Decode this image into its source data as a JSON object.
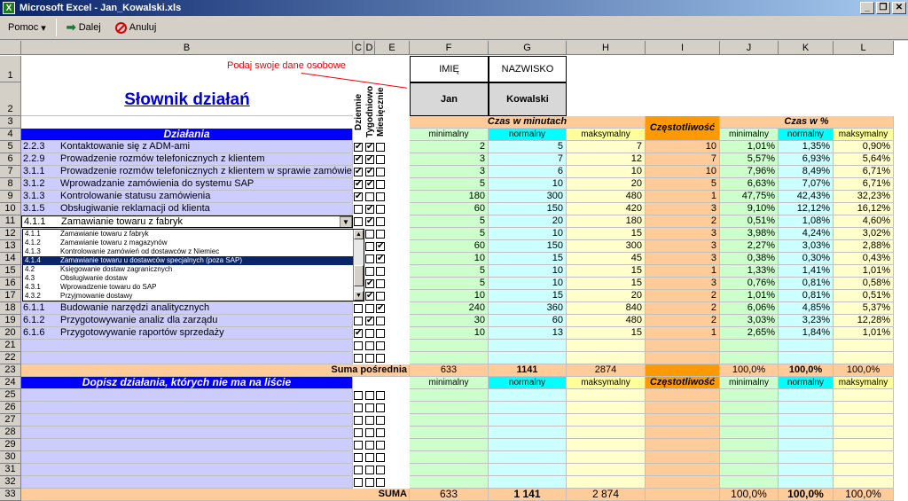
{
  "window": {
    "title": "Microsoft Excel - Jan_Kowalski.xls",
    "app_icon": "X"
  },
  "toolbar": {
    "help": "Pomoc",
    "next": "Dalej",
    "cancel": "Anuluj"
  },
  "columns": [
    "B",
    "C",
    "D",
    "E",
    "F",
    "G",
    "H",
    "I",
    "J",
    "K",
    "L"
  ],
  "rows": [
    "1",
    "2",
    "3",
    "4",
    "5",
    "6",
    "7",
    "8",
    "9",
    "10",
    "11",
    "12",
    "13",
    "14",
    "15",
    "16",
    "17",
    "18",
    "19",
    "20",
    "21",
    "22",
    "23",
    "24",
    "25",
    "26",
    "27",
    "28",
    "29",
    "30",
    "31",
    "32",
    "33"
  ],
  "sheet": {
    "title": "Słownik działań",
    "hint": "Podaj swoje dane osobowe",
    "headers": {
      "first_name": "IMIĘ",
      "last_name": "NAZWISKO"
    },
    "person": {
      "first_name": "Jan",
      "last_name": "Kowalski"
    },
    "freq_labels": [
      "Dziennie",
      "Tygodniowo",
      "Miesięcznie"
    ],
    "section_actions": "Działania",
    "time_header": "Czas w minutach",
    "frequency": "Częstotliwość",
    "pct_header": "Czas w %",
    "sub": [
      "minimalny",
      "normalny",
      "maksymalny"
    ],
    "activities": [
      {
        "code": "2.2.3",
        "name": "Kontaktowanie się z ADM-ami",
        "checks": [
          1,
          1,
          0
        ],
        "min": "2",
        "norm": "5",
        "max": "7",
        "freq": "10",
        "pmin": "1,01%",
        "pnorm": "1,35%",
        "pmax": "0,90%"
      },
      {
        "code": "2.2.9",
        "name": "Prowadzenie rozmów telefonicznych z klientem",
        "checks": [
          1,
          1,
          0
        ],
        "min": "3",
        "norm": "7",
        "max": "12",
        "freq": "7",
        "pmin": "5,57%",
        "pnorm": "6,93%",
        "pmax": "5,64%"
      },
      {
        "code": "3.1.1",
        "name": "Prowadzenie rozmów telefonicznych z klientem w sprawie zamówień",
        "checks": [
          1,
          1,
          0
        ],
        "min": "3",
        "norm": "6",
        "max": "10",
        "freq": "10",
        "pmin": "7,96%",
        "pnorm": "8,49%",
        "pmax": "6,71%"
      },
      {
        "code": "3.1.2",
        "name": "Wprowadzanie zamówienia do systemu SAP",
        "checks": [
          1,
          1,
          0
        ],
        "min": "5",
        "norm": "10",
        "max": "20",
        "freq": "5",
        "pmin": "6,63%",
        "pnorm": "7,07%",
        "pmax": "6,71%"
      },
      {
        "code": "3.1.3",
        "name": "Kontrolowanie statusu zamówienia",
        "checks": [
          1,
          0,
          0
        ],
        "min": "180",
        "norm": "300",
        "max": "480",
        "freq": "1",
        "pmin": "47,75%",
        "pnorm": "42,43%",
        "pmax": "32,23%"
      },
      {
        "code": "3.1.5",
        "name": "Obsługiwanie reklamacji od klienta",
        "checks": [
          0,
          1,
          0
        ],
        "min": "60",
        "norm": "150",
        "max": "420",
        "freq": "3",
        "pmin": "9,10%",
        "pnorm": "12,12%",
        "pmax": "16,12%"
      },
      {
        "code": "4.1.1",
        "name": "Zamawianie towaru z fabryk",
        "checks": [
          0,
          1,
          0
        ],
        "min": "5",
        "norm": "20",
        "max": "180",
        "freq": "2",
        "pmin": "0,51%",
        "pnorm": "1,08%",
        "pmax": "4,60%"
      },
      {
        "code": "",
        "name": "",
        "checks": [
          1,
          0,
          0
        ],
        "min": "5",
        "norm": "10",
        "max": "15",
        "freq": "3",
        "pmin": "3,98%",
        "pnorm": "4,24%",
        "pmax": "3,02%"
      },
      {
        "code": "",
        "name": "",
        "checks": [
          0,
          0,
          1
        ],
        "min": "60",
        "norm": "150",
        "max": "300",
        "freq": "3",
        "pmin": "2,27%",
        "pnorm": "3,03%",
        "pmax": "2,88%"
      },
      {
        "code": "",
        "name": "",
        "checks": [
          0,
          0,
          1
        ],
        "min": "10",
        "norm": "15",
        "max": "45",
        "freq": "3",
        "pmin": "0,38%",
        "pnorm": "0,30%",
        "pmax": "0,43%"
      },
      {
        "code": "",
        "name": "",
        "checks": [
          1,
          0,
          0
        ],
        "min": "5",
        "norm": "10",
        "max": "15",
        "freq": "1",
        "pmin": "1,33%",
        "pnorm": "1,41%",
        "pmax": "1,01%"
      },
      {
        "code": "",
        "name": "",
        "checks": [
          0,
          1,
          0
        ],
        "min": "5",
        "norm": "10",
        "max": "15",
        "freq": "3",
        "pmin": "0,76%",
        "pnorm": "0,81%",
        "pmax": "0,58%"
      },
      {
        "code": "",
        "name": "",
        "checks": [
          0,
          1,
          0
        ],
        "min": "10",
        "norm": "15",
        "max": "20",
        "freq": "2",
        "pmin": "1,01%",
        "pnorm": "0,81%",
        "pmax": "0,51%"
      },
      {
        "code": "6.1.1",
        "name": "Budowanie narzędzi analitycznych",
        "checks": [
          0,
          0,
          1
        ],
        "min": "240",
        "norm": "360",
        "max": "840",
        "freq": "2",
        "pmin": "6,06%",
        "pnorm": "4,85%",
        "pmax": "5,37%"
      },
      {
        "code": "6.1.2",
        "name": "Przygotowywanie analiz dla zarządu",
        "checks": [
          0,
          1,
          0
        ],
        "min": "30",
        "norm": "60",
        "max": "480",
        "freq": "2",
        "pmin": "3,03%",
        "pnorm": "3,23%",
        "pmax": "12,28%"
      },
      {
        "code": "6.1.6",
        "name": "Przygotowywanie raportów sprzedaży",
        "checks": [
          1,
          0,
          0
        ],
        "min": "10",
        "norm": "13",
        "max": "15",
        "freq": "1",
        "pmin": "2,65%",
        "pnorm": "1,84%",
        "pmax": "1,01%"
      }
    ],
    "subtotal": {
      "label": "Suma pośrednia",
      "min": "633",
      "norm": "1141",
      "max": "2874",
      "pmin": "100,0%",
      "pnorm": "100,0%",
      "pmax": "100,0%"
    },
    "add_label": "Dopisz działania, których nie ma na liście",
    "total": {
      "label": "SUMA",
      "min": "633",
      "norm": "1 141",
      "max": "2 874",
      "pmin": "100,0%",
      "pnorm": "100,0%",
      "pmax": "100,0%"
    }
  },
  "dropdown": {
    "items": [
      {
        "code": "4.1.1",
        "label": "Zamawianie towaru z fabryk"
      },
      {
        "code": "4.1.2",
        "label": "Zamawianie towaru z magazynów"
      },
      {
        "code": "4.1.3",
        "label": "Kontrolowanie zamówień od dostawców z Niemiec"
      },
      {
        "code": "4.1.4",
        "label": "Zamawianie towaru u dostawców specjalnych (poza SAP)"
      },
      {
        "code": "4.2",
        "label": "Księgowanie dostaw zagranicznych"
      },
      {
        "code": "4.3",
        "label": "Obsługiwanie dostaw"
      },
      {
        "code": "4.3.1",
        "label": "Wprowadzenie towaru do SAP"
      },
      {
        "code": "4.3.2",
        "label": "Przyjmowanie dostawy"
      }
    ],
    "selected_index": 3
  },
  "colors": {
    "blue_header": "#0000ff",
    "green": "#ccffcc",
    "cyan": "#00ffff",
    "yellow": "#ffff99",
    "orange": "#ff9900",
    "peach": "#ffcc99",
    "lavender": "#ccccff",
    "light_yellow": "#ffffcc",
    "light_cyan": "#ccffff"
  }
}
